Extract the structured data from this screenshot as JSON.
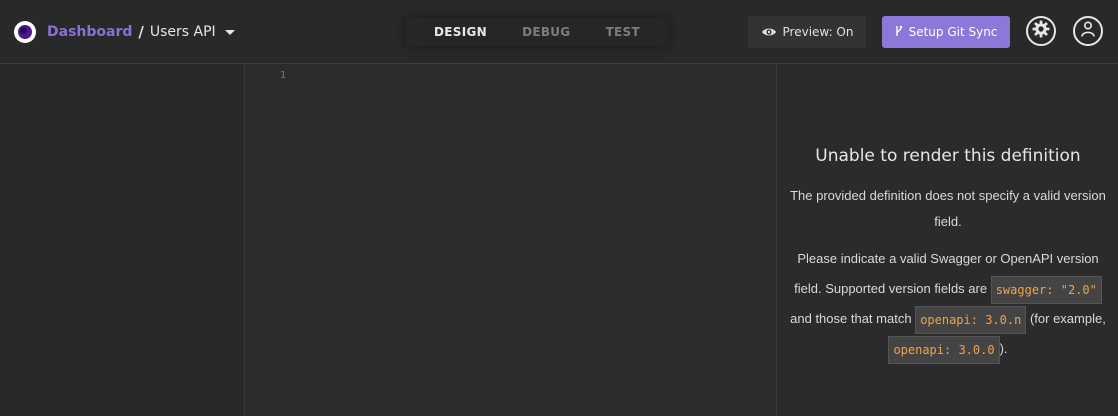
{
  "header": {
    "breadcrumb": {
      "dashboard": "Dashboard",
      "separator": "/",
      "project": "Users API"
    },
    "tabs": [
      {
        "label": "DESIGN",
        "active": true
      },
      {
        "label": "DEBUG",
        "active": false
      },
      {
        "label": "TEST",
        "active": false
      }
    ],
    "preview_button": {
      "label": "Preview: On",
      "icon": "eye-icon"
    },
    "git_button": {
      "label": "Setup Git Sync",
      "icon": "git-branch-icon"
    },
    "settings_icon": "gear-icon",
    "account_icon": "user-icon"
  },
  "editor": {
    "line_numbers": [
      "1"
    ]
  },
  "preview": {
    "title": "Unable to render this definition",
    "message1": "The provided definition does not specify a valid version field.",
    "message2_part1": "Please indicate a valid Swagger or OpenAPI version field. Supported version fields are",
    "code1": "swagger: \"2.0\"",
    "message2_part2": "and those that match",
    "code2": "openapi: 3.0.n",
    "message2_part3": "(for example,",
    "code3": "openapi: 3.0.0",
    "message2_part4": ")."
  },
  "colors": {
    "accent": "#8d77d9",
    "breadcrumb_link": "#8b6fd6",
    "code_text": "#f0a24a",
    "background": "#2b2b2d"
  }
}
